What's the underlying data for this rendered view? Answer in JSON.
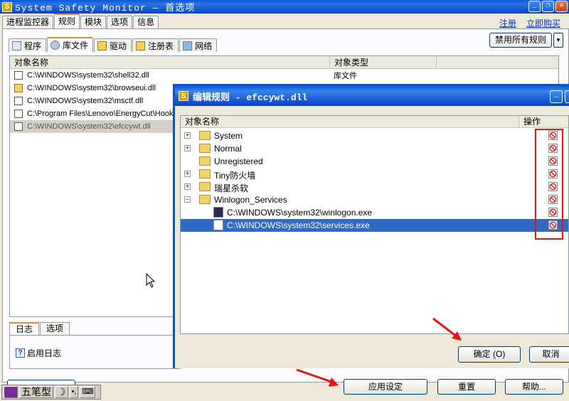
{
  "window": {
    "title": "System Safety Monitor — 首选项",
    "icon_letter": "S"
  },
  "top_tabs": [
    "进程监控器",
    "规则",
    "模块",
    "选项",
    "信息"
  ],
  "top_links": {
    "register": "注册",
    "buy": "立即购买"
  },
  "sub_tabs": [
    "程序",
    "库文件",
    "驱动",
    "注册表",
    "网络"
  ],
  "disable_all_label": "禁用所有规则",
  "list": {
    "columns": [
      "对象名称",
      "对象类型"
    ],
    "rows": [
      {
        "name": "C:\\WINDOWS\\system32\\shell32.dll",
        "type": "库文件"
      },
      {
        "name": "C:\\WINDOWS\\system32\\browseui.dll",
        "type": ""
      },
      {
        "name": "C:\\WINDOWS\\system32\\msctf.dll",
        "type": ""
      },
      {
        "name": "C:\\Program Files\\Lenovo\\EnergyCut\\Hook",
        "type": ""
      },
      {
        "name": "C:\\WINDOWS\\system32\\efccywt.dll",
        "type": ""
      }
    ]
  },
  "log_tabs": [
    "日志",
    "选项"
  ],
  "enable_log_label": "启用日志",
  "bottom_buttons": {
    "apply": "应用设定",
    "reset": "重置",
    "help": "帮助..."
  },
  "ime": {
    "label": "五笔型"
  },
  "dialog": {
    "title": "编辑规则 - efccywt.dll",
    "columns": {
      "name": "对象名称",
      "action": "操作"
    },
    "rows": [
      {
        "label": "System"
      },
      {
        "label": "Normal"
      },
      {
        "label": "Unregistered"
      },
      {
        "label": "Tiny防火墙"
      },
      {
        "label": "瑞星杀软"
      },
      {
        "label": "Winlogon_Services"
      },
      {
        "label": "C:\\WINDOWS\\system32\\winlogon.exe"
      },
      {
        "label": "C:\\WINDOWS\\system32\\services.exe"
      }
    ],
    "ok_label": "确定 (O)",
    "cancel_label": "取消"
  },
  "colors": {
    "accent": "#316ac5",
    "annotation": "#ee1111",
    "block": "#d02020"
  }
}
